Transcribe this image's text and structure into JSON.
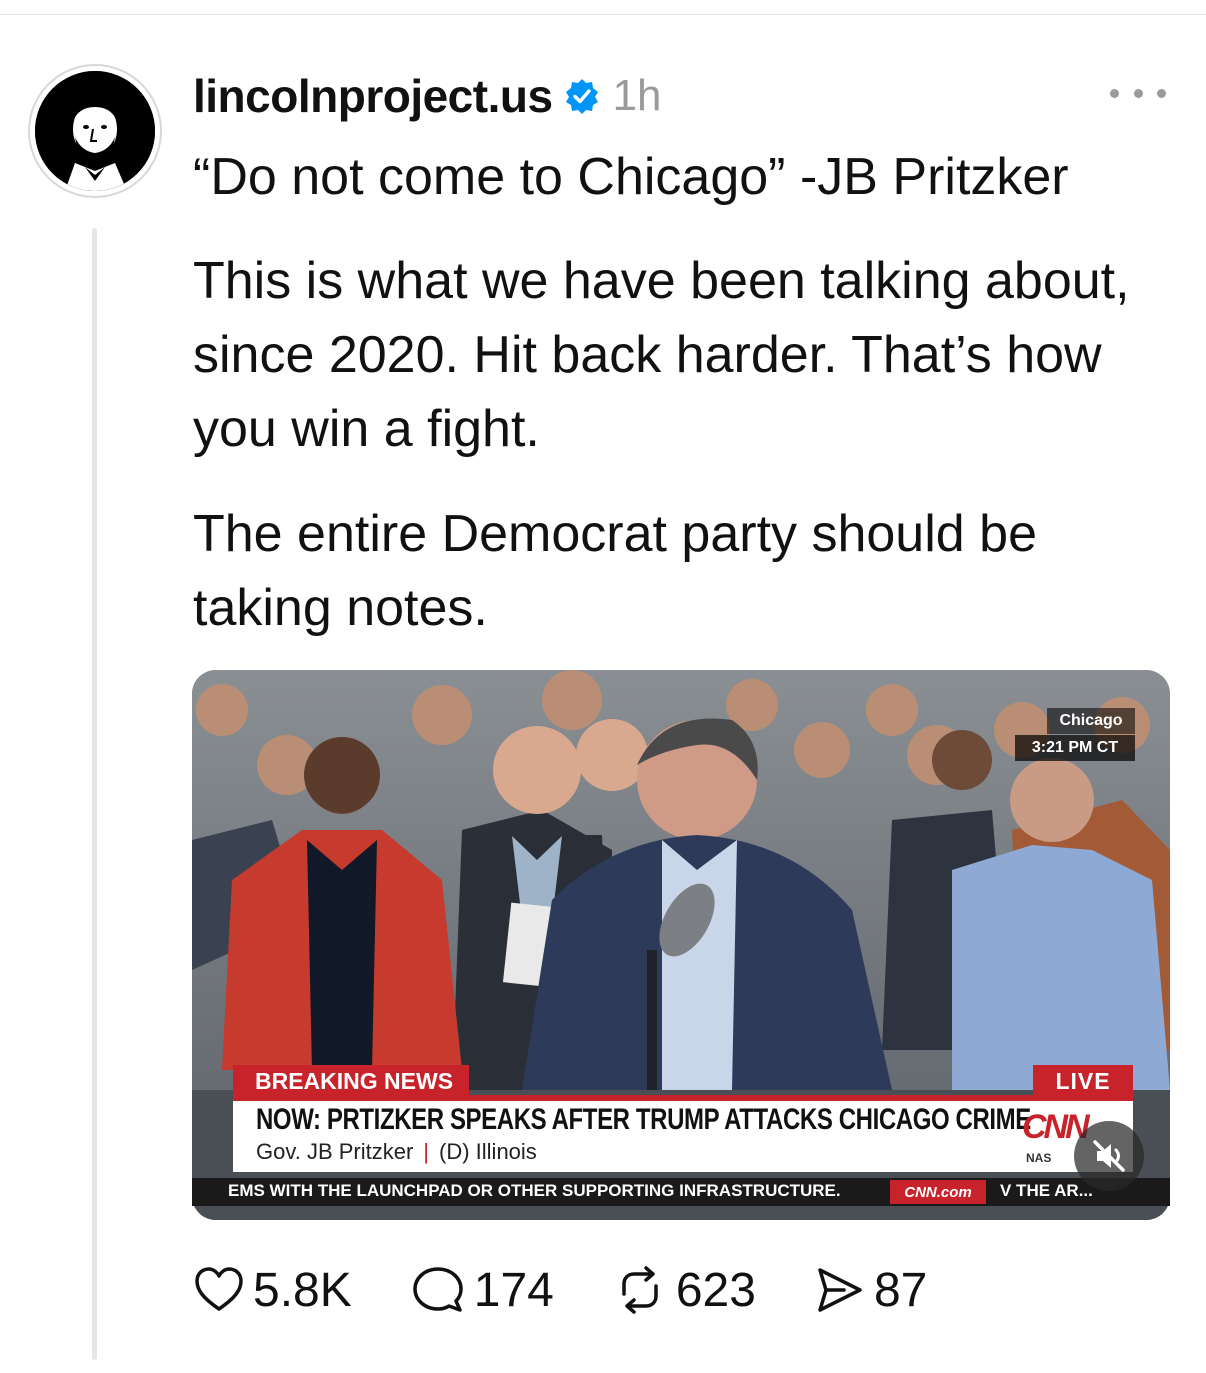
{
  "post": {
    "username": "lincolnproject.us",
    "time": "1h",
    "paragraphs": [
      "“Do not come to Chicago” -JB Pritzker",
      "This is what we have been talking about, since 2020. Hit back harder. That’s how you win a fight.",
      "The entire Democrat party should be taking notes."
    ]
  },
  "video": {
    "location": "Chicago",
    "clock": "3:21 PM CT",
    "breaking_label": "BREAKING NEWS",
    "live_label": "LIVE",
    "headline": "NOW: PRTIZKER SPEAKS AFTER TRUMP ATTACKS CHICAGO CRIME",
    "speaker_name": "Gov. JB Pritzker",
    "speaker_party": "(D) Illinois",
    "network": "CNN",
    "market_tag": "NAS",
    "ticker_left": "EMS WITH THE LAUNCHPAD OR OTHER SUPPORTING INFRASTRUCTURE.",
    "ticker_brand": "CNN.com",
    "ticker_right": "V THE AR...",
    "muted": true
  },
  "actions": {
    "likes": "5.8K",
    "replies": "174",
    "reposts": "623",
    "shares": "87"
  },
  "colors": {
    "verified_blue": "#0095f6",
    "cnn_red": "#c8232b",
    "muted_text": "#9a9a9a"
  },
  "icons": [
    "verified-badge-icon",
    "more-options-icon",
    "heart-icon",
    "comment-icon",
    "repost-icon",
    "share-icon",
    "speaker-muted-icon"
  ]
}
